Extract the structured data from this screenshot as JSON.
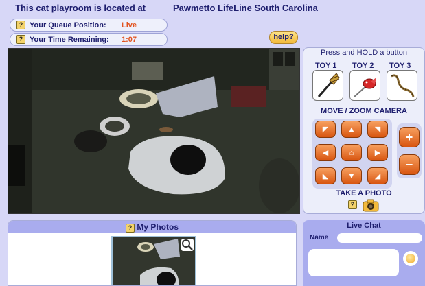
{
  "header": {
    "title": "This cat playroom is located at",
    "location": "Pawmetto LifeLine South Carolina"
  },
  "status": {
    "queue_label": "Your Queue Position:",
    "queue_value": "Live",
    "time_label": "Your Time Remaining:",
    "time_value": "1:07",
    "help_mark": "?"
  },
  "help_button": "help?",
  "controls": {
    "instruction": "Press and HOLD a button",
    "toys": [
      {
        "label": "TOY 1"
      },
      {
        "label": "TOY 2"
      },
      {
        "label": "TOY 3"
      }
    ],
    "move_zoom_title": "MOVE / ZOOM CAMERA",
    "zoom_in": "+",
    "zoom_out": "−",
    "take_photo": "TAKE A PHOTO",
    "help_mark": "?"
  },
  "photos": {
    "title": "My Photos",
    "help_mark": "?"
  },
  "chat": {
    "title": "Live Chat",
    "name_label": "Name",
    "name_value": "",
    "message_value": ""
  }
}
